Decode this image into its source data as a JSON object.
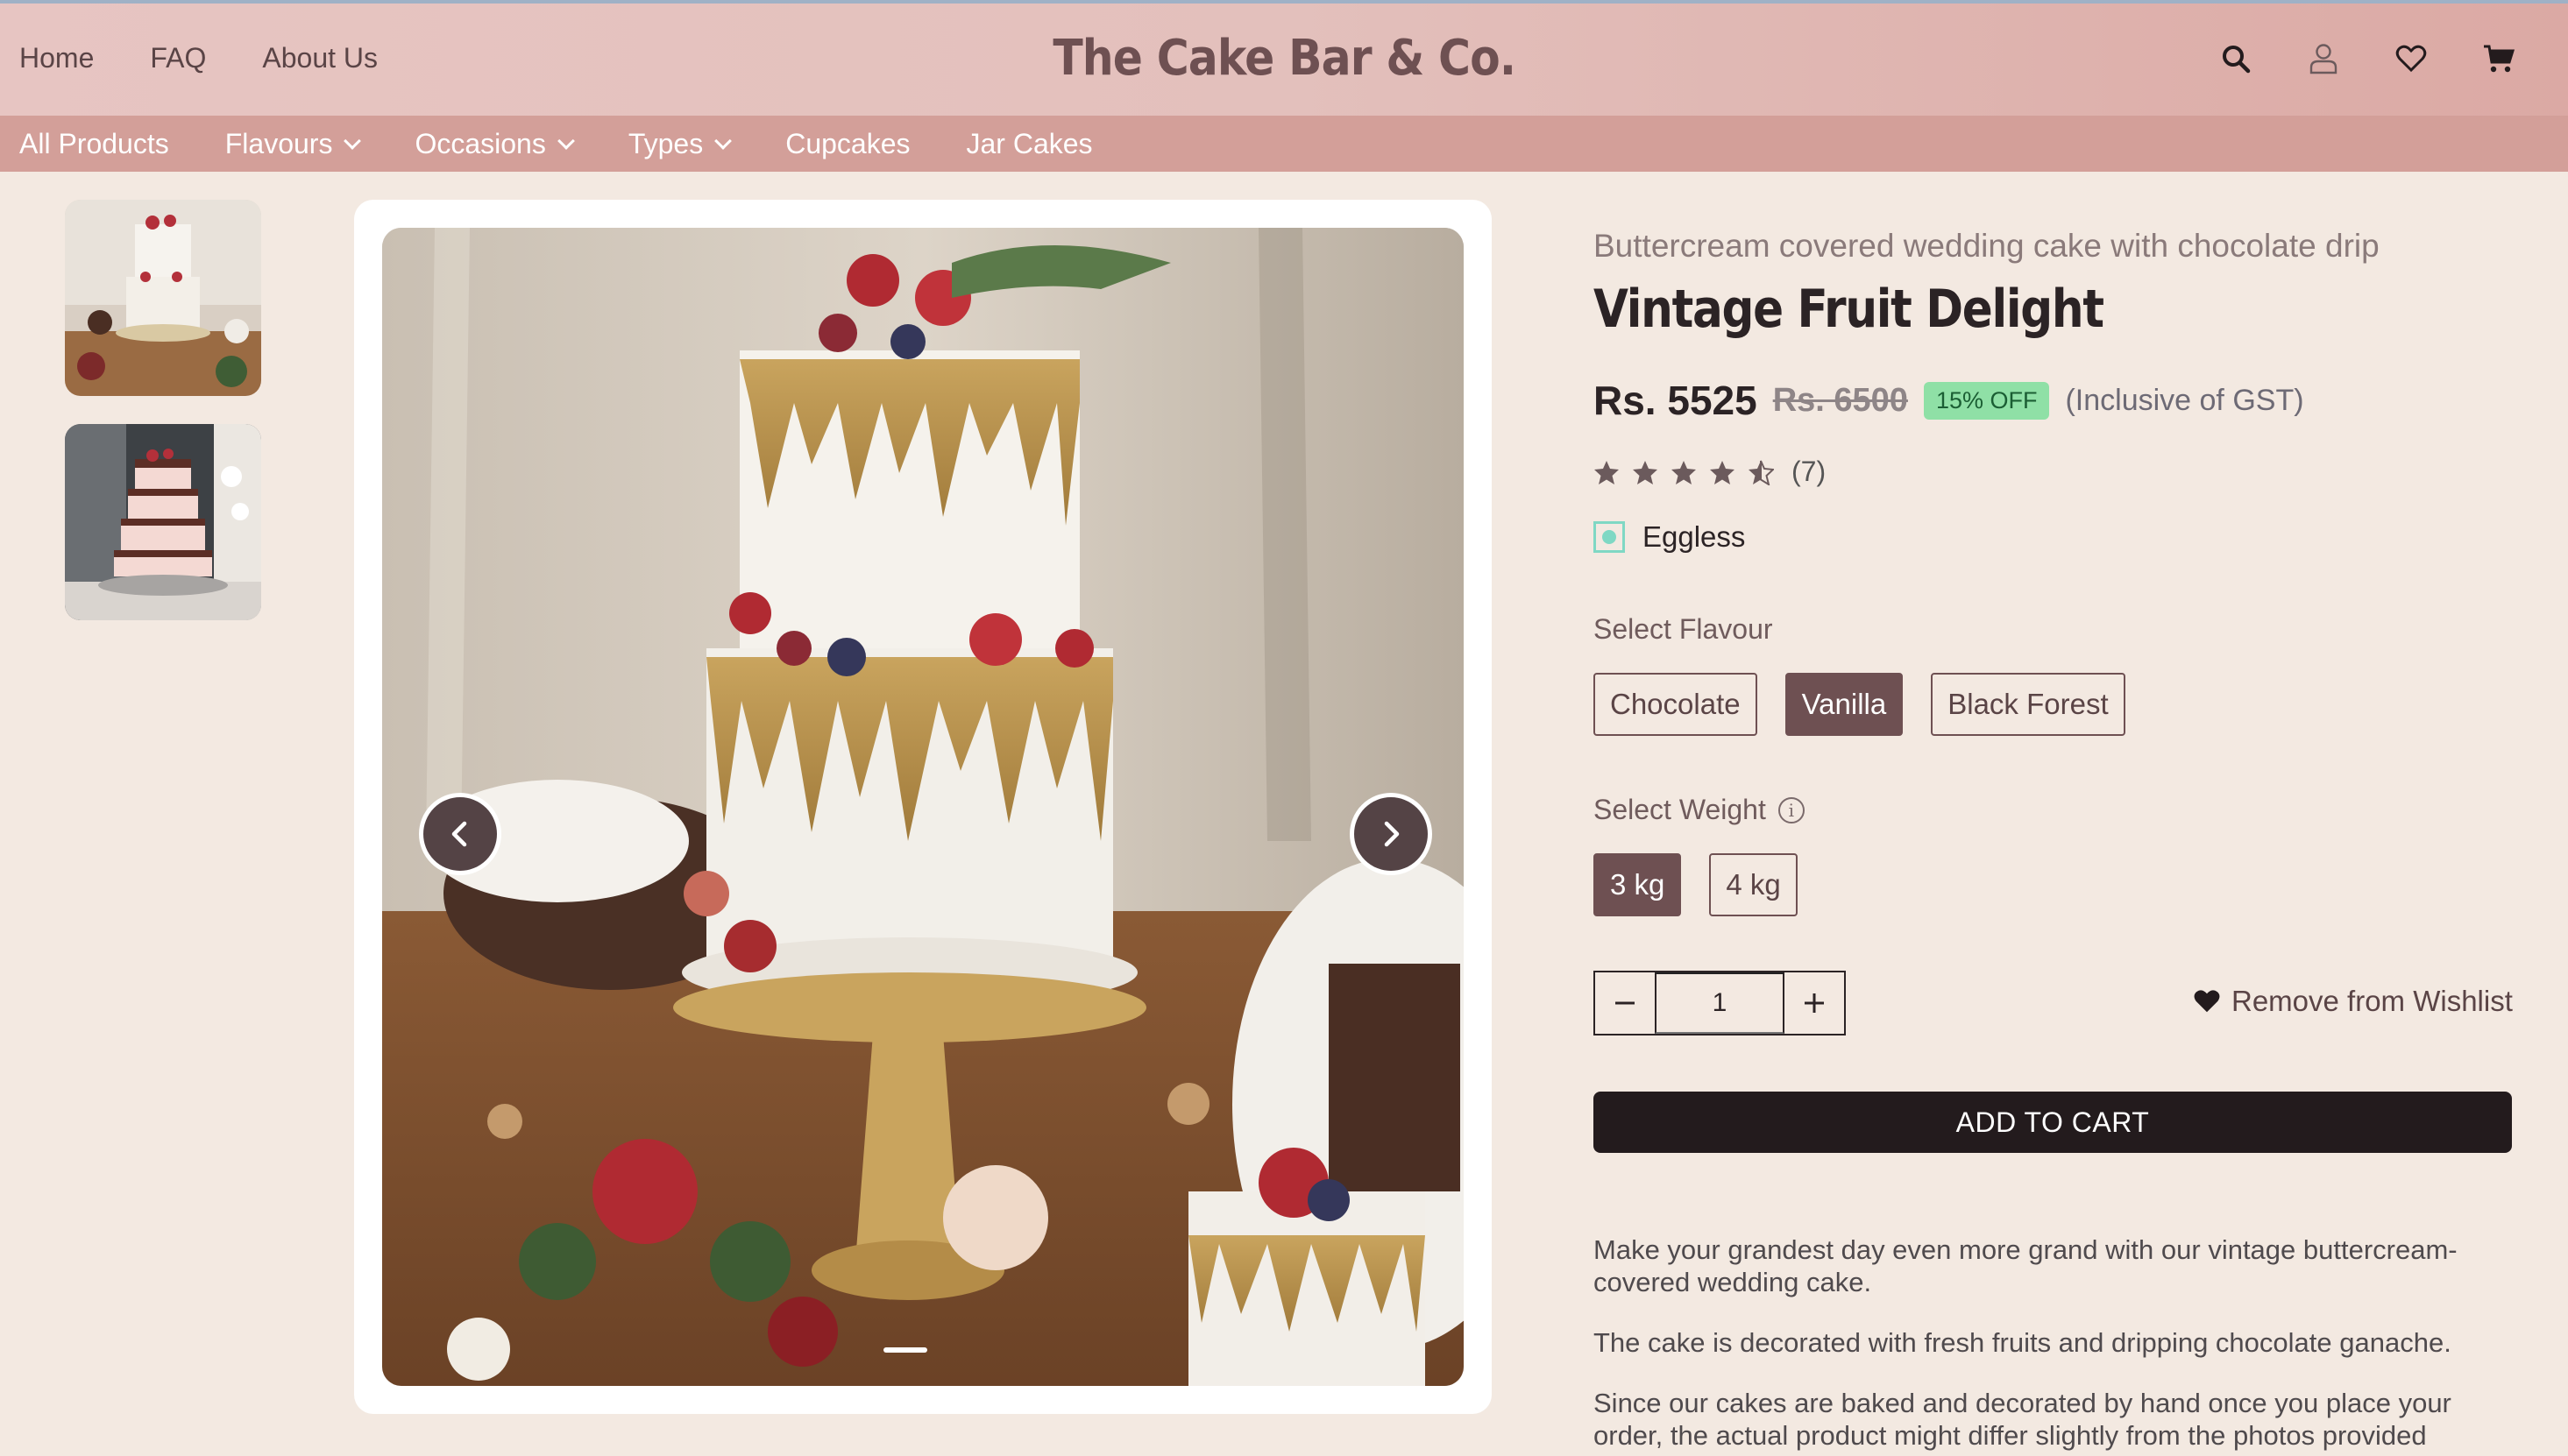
{
  "header": {
    "nav": [
      "Home",
      "FAQ",
      "About Us"
    ],
    "brand": "The Cake Bar & Co.",
    "icons": [
      "search-icon",
      "user-icon",
      "heart-icon",
      "cart-icon"
    ]
  },
  "categories": {
    "all": "All Products",
    "flavours": "Flavours",
    "occasions": "Occasions",
    "types": "Types",
    "cupcakes": "Cupcakes",
    "jar": "Jar Cakes"
  },
  "product": {
    "subtitle": "Buttercream covered wedding cake with chocolate drip",
    "title": "Vintage Fruit Delight",
    "price": "Rs. 5525",
    "old_price": "Rs. 6500",
    "discount": "15% OFF",
    "gst": "(Inclusive of GST)",
    "rating": 4.5,
    "rating_count": "(7)",
    "eggless": "Eggless",
    "flavour_label": "Select Flavour",
    "flavours": [
      "Chocolate",
      "Vanilla",
      "Black Forest"
    ],
    "selected_flavour": "Vanilla",
    "weight_label": "Select Weight",
    "info_glyph": "i",
    "weights": [
      "3 kg",
      "4 kg"
    ],
    "selected_weight": "3 kg",
    "quantity": "1",
    "wishlist": "Remove from Wishlist",
    "add_to_cart": "ADD TO CART",
    "description": [
      "Make your grandest day even more grand with our vintage buttercream-covered wedding cake.",
      "The cake is decorated with fresh fruits and dripping chocolate ganache.",
      "Since our cakes are baked and decorated by hand once you place your order, the actual product might differ slightly from the photos provided"
    ]
  },
  "colors": {
    "header": "#e3c0bc",
    "category_bar": "#d39f99",
    "accent": "#6e5052",
    "page_bg": "#f3e9e1",
    "badge": "#8fe0a6"
  }
}
